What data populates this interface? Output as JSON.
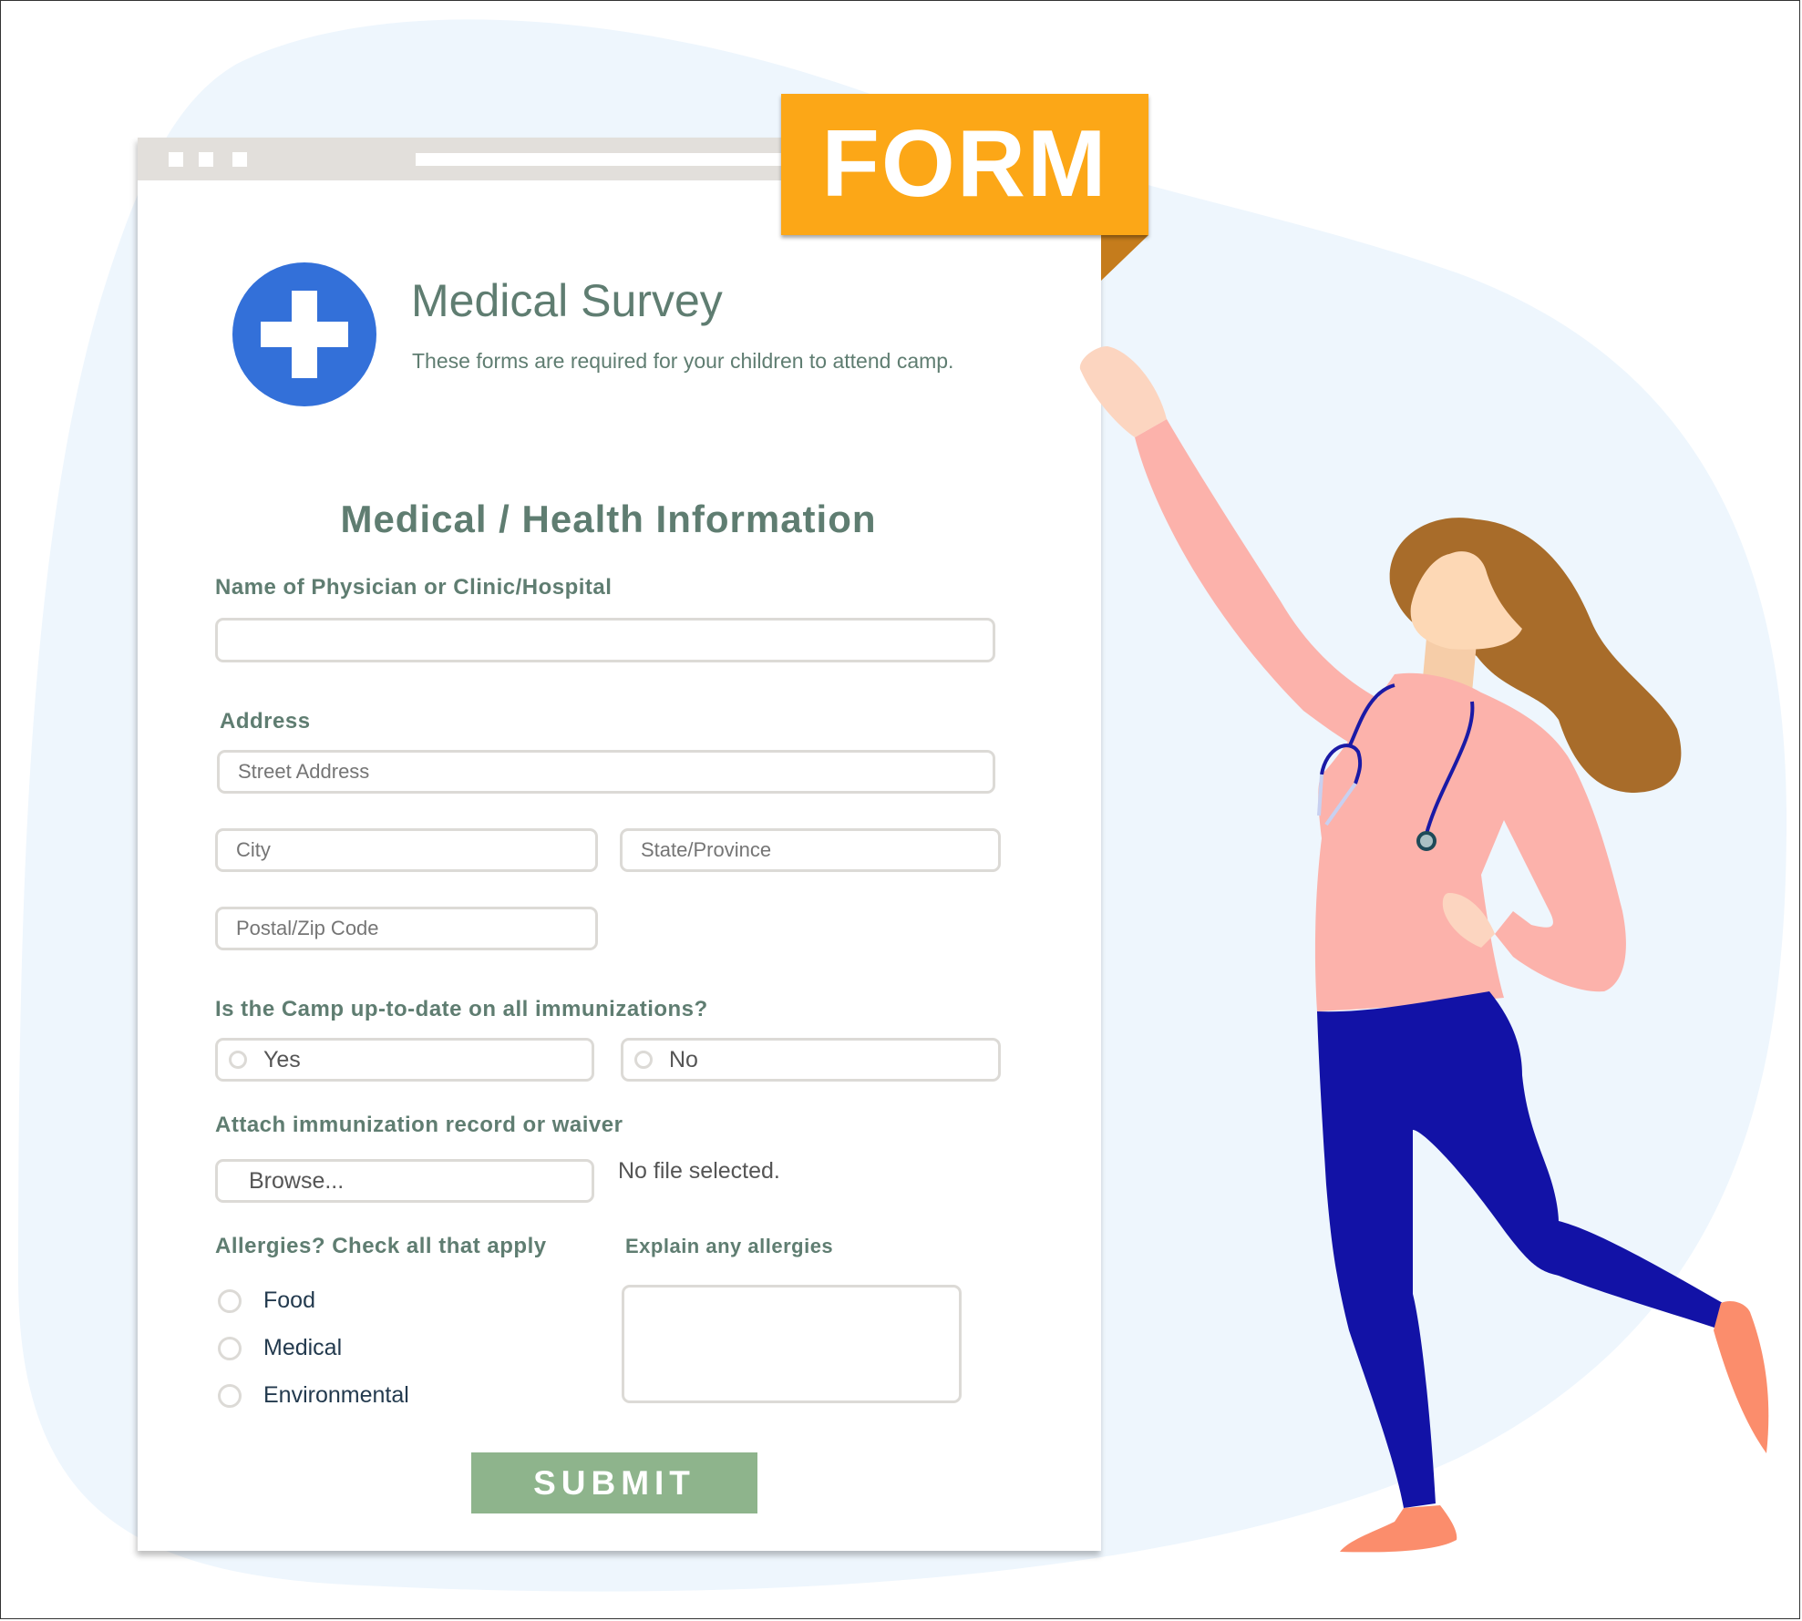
{
  "badge": {
    "label": "FORM"
  },
  "header": {
    "title": "Medical Survey",
    "subtitle": "These forms are required for your children to attend camp."
  },
  "section_title": "Medical / Health Information",
  "fields": {
    "physician": {
      "label": "Name of Physician or Clinic/Hospital",
      "value": "",
      "placeholder": ""
    },
    "address": {
      "label": "Address",
      "street_placeholder": "Street Address",
      "city_placeholder": "City",
      "state_placeholder": "State/Province",
      "zip_placeholder": "Postal/Zip Code"
    },
    "immunizations": {
      "label": "Is the Camp up-to-date on all immunizations?",
      "options": [
        "Yes",
        "No"
      ]
    },
    "attachment": {
      "label": "Attach immunization record or waiver",
      "browse_label": "Browse...",
      "status": "No file selected."
    },
    "allergies": {
      "label": "Allergies? Check all that apply",
      "options": [
        "Food",
        "Medical",
        "Environmental"
      ]
    },
    "explain": {
      "label": "Explain any allergies",
      "value": ""
    }
  },
  "submit_label": "SUBMIT",
  "colors": {
    "accent_green": "#8eb48c",
    "text_green": "#5f7d71",
    "badge_orange": "#fca717",
    "logo_blue": "#3370d9",
    "background_blob": "#eef6fd"
  }
}
